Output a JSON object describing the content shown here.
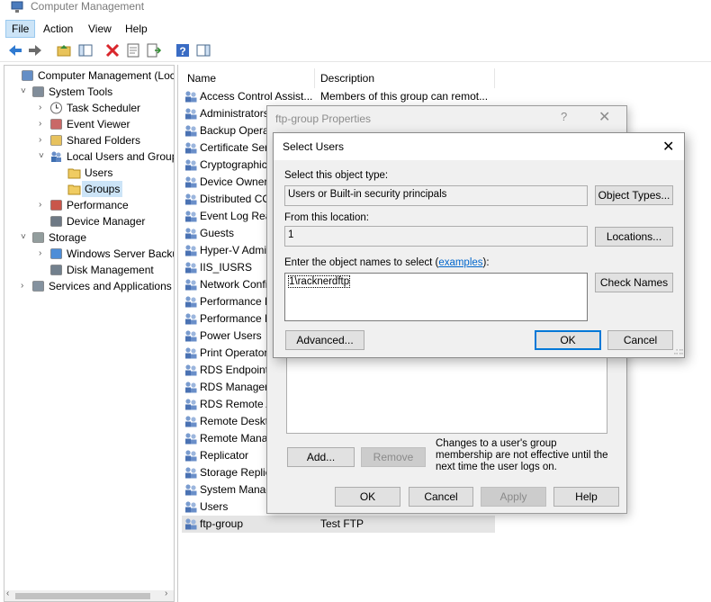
{
  "window": {
    "title": "Computer Management"
  },
  "menu": [
    "File",
    "Action",
    "View",
    "Help"
  ],
  "tree": [
    {
      "label": "Computer Management (Local",
      "level": 0,
      "expander": "",
      "icon": "computer-management-icon"
    },
    {
      "label": "System Tools",
      "level": 1,
      "expander": "˅",
      "icon": "system-tools-icon"
    },
    {
      "label": "Task Scheduler",
      "level": 2,
      "expander": "›",
      "icon": "clock-icon"
    },
    {
      "label": "Event Viewer",
      "level": 2,
      "expander": "›",
      "icon": "event-viewer-icon"
    },
    {
      "label": "Shared Folders",
      "level": 2,
      "expander": "›",
      "icon": "shared-folder-icon"
    },
    {
      "label": "Local Users and Groups",
      "level": 2,
      "expander": "˅",
      "icon": "users-icon"
    },
    {
      "label": "Users",
      "level": 3,
      "expander": "",
      "icon": "folder-icon"
    },
    {
      "label": "Groups",
      "level": 3,
      "expander": "",
      "icon": "folder-icon",
      "selected": true
    },
    {
      "label": "Performance",
      "level": 2,
      "expander": "›",
      "icon": "performance-icon"
    },
    {
      "label": "Device Manager",
      "level": 2,
      "expander": "",
      "icon": "device-manager-icon"
    },
    {
      "label": "Storage",
      "level": 1,
      "expander": "˅",
      "icon": "storage-icon"
    },
    {
      "label": "Windows Server Backup",
      "level": 2,
      "expander": "›",
      "icon": "backup-icon"
    },
    {
      "label": "Disk Management",
      "level": 2,
      "expander": "",
      "icon": "disk-icon"
    },
    {
      "label": "Services and Applications",
      "level": 1,
      "expander": "›",
      "icon": "services-icon"
    }
  ],
  "list": {
    "columns": [
      "Name",
      "Description"
    ],
    "rows": [
      {
        "name": "Access Control Assist...",
        "desc": "Members of this group can remot..."
      },
      {
        "name": "Administrators",
        "desc": ""
      },
      {
        "name": "Backup Operat",
        "desc": ""
      },
      {
        "name": "Certificate Serv",
        "desc": ""
      },
      {
        "name": "Cryptographic",
        "desc": ""
      },
      {
        "name": "Device Owners",
        "desc": ""
      },
      {
        "name": "Distributed CO",
        "desc": ""
      },
      {
        "name": "Event Log Rea",
        "desc": ""
      },
      {
        "name": "Guests",
        "desc": ""
      },
      {
        "name": "Hyper-V Admi",
        "desc": ""
      },
      {
        "name": "IIS_IUSRS",
        "desc": ""
      },
      {
        "name": "Network Confi",
        "desc": ""
      },
      {
        "name": "Performance L",
        "desc": ""
      },
      {
        "name": "Performance M",
        "desc": ""
      },
      {
        "name": "Power Users",
        "desc": ""
      },
      {
        "name": "Print Operator",
        "desc": ""
      },
      {
        "name": "RDS Endpoint",
        "desc": ""
      },
      {
        "name": "RDS Managem",
        "desc": ""
      },
      {
        "name": "RDS Remote A",
        "desc": ""
      },
      {
        "name": "Remote Deskto",
        "desc": ""
      },
      {
        "name": "Remote Manag",
        "desc": ""
      },
      {
        "name": "Replicator",
        "desc": ""
      },
      {
        "name": "Storage Replic",
        "desc": ""
      },
      {
        "name": "System Manag",
        "desc": ""
      },
      {
        "name": "Users",
        "desc": ""
      },
      {
        "name": "ftp-group",
        "desc": "Test FTP",
        "selected": true
      }
    ]
  },
  "props_dialog": {
    "title": "ftp-group Properties",
    "help": "?",
    "close": "✕",
    "add_button": "Add...",
    "remove_button": "Remove",
    "note": "Changes to a user's group membership are not effective until the next time the user logs on.",
    "ok": "OK",
    "cancel": "Cancel",
    "apply": "Apply",
    "help_button": "Help"
  },
  "select_dialog": {
    "title": "Select Users",
    "close": "✕",
    "object_type_label": "Select this object type:",
    "object_type_value": "Users or Built-in security principals",
    "object_types_button": "Object Types...",
    "location_label": "From this location:",
    "location_value": "1",
    "locations_button": "Locations...",
    "names_label_prefix": "Enter the object names to select (",
    "names_label_link": "examples",
    "names_label_suffix": "):",
    "names_value": "1\\racknerdftp",
    "check_names_button": "Check Names",
    "advanced_button": "Advanced...",
    "ok": "OK",
    "cancel": "Cancel"
  },
  "colors": {
    "accent": "#0078d7",
    "selection": "#cce4f7"
  }
}
